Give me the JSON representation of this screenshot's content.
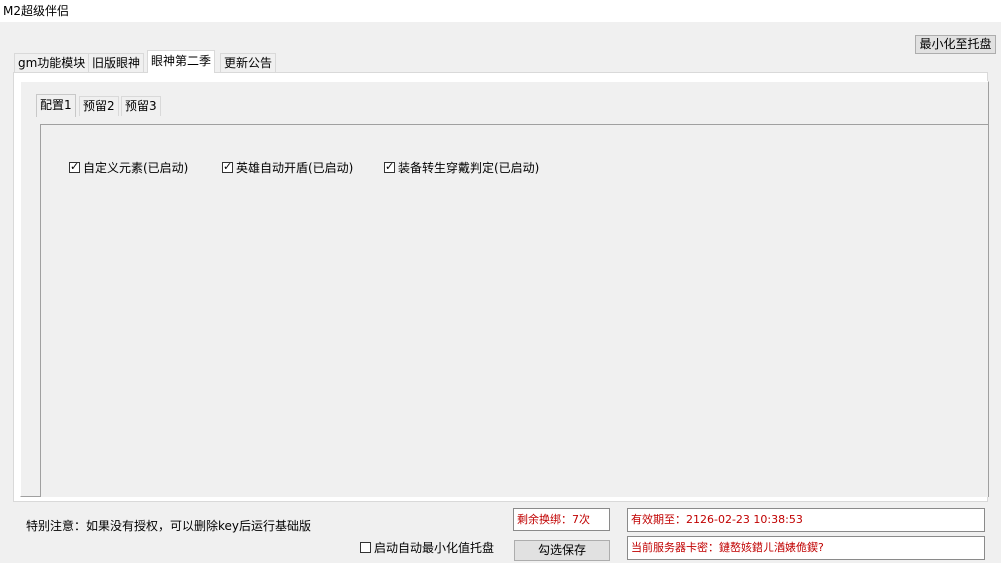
{
  "window": {
    "title": "M2超级伴侣"
  },
  "toolbar": {
    "minimize_tray_label": "最小化至托盘"
  },
  "tabs": [
    {
      "label": "gm功能模块"
    },
    {
      "label": "旧版眼神"
    },
    {
      "label": "眼神第二季"
    },
    {
      "label": "更新公告"
    }
  ],
  "subtabs": [
    {
      "label": "配置1"
    },
    {
      "label": "预留2"
    },
    {
      "label": "预留3"
    }
  ],
  "options": [
    {
      "label": "自定义元素(已启动)",
      "checked": true
    },
    {
      "label": "英雄自动开盾(已启动)",
      "checked": true
    },
    {
      "label": "装备转生穿戴判定(已启动)",
      "checked": true
    }
  ],
  "footer": {
    "note": "特别注意：如果没有授权，可以删除key后运行基础版",
    "auto_minimize_label": "启动自动最小化值托盘",
    "remaining_bind": "剩余换绑：7次",
    "expiry": "有效期至：2126-02-23 10:38:53",
    "server_key": "当前服务器卡密：鏈嶅姟鍣ㄦ湭婊佹鍥?",
    "save_label": "勾选保存"
  },
  "colors": {
    "status_text": "#c00000",
    "active_tab_bg": "#ffffff"
  }
}
